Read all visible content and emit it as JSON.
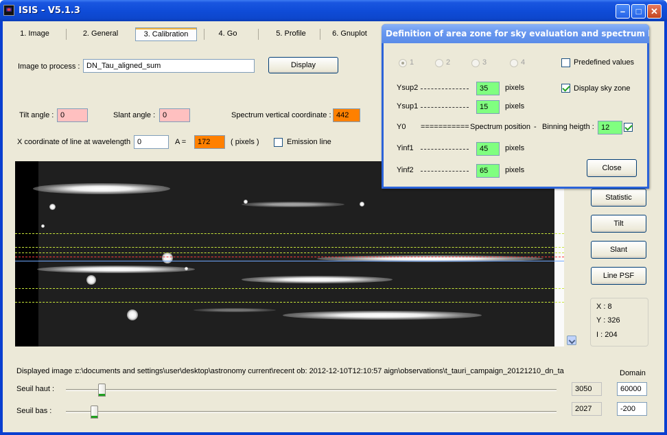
{
  "window": {
    "title": "ISIS - V5.1.3"
  },
  "tabs": [
    {
      "label": "1. Image"
    },
    {
      "label": "2. General"
    },
    {
      "label": "3. Calibration",
      "active": true
    },
    {
      "label": "4. Go"
    },
    {
      "label": "5. Profile"
    },
    {
      "label": "6. Gnuplot"
    }
  ],
  "image_to_process": {
    "label": "Image to process :",
    "value": "DN_Tau_aligned_sum",
    "display_button": "Display"
  },
  "tilt": {
    "label": "Tilt angle :",
    "value": "0"
  },
  "slant": {
    "label": "Slant angle :",
    "value": "0"
  },
  "spectrum_vertical": {
    "label": "Spectrum vertical coordinate :",
    "value": "442"
  },
  "x_coord": {
    "label": "X coordinate of line at wavelength",
    "value": "0",
    "a_label": "A  =",
    "a_value": "172",
    "pixels_label": "( pixels )",
    "emission_label": "Emission line",
    "emission_checked": false
  },
  "side_buttons": {
    "statistic": "Statistic",
    "tilt": "Tilt",
    "slant": "Slant",
    "line_psf": "Line PSF"
  },
  "readout": {
    "x": "X : 8",
    "y": "Y : 326",
    "i": "I   : 204"
  },
  "displayed_image": {
    "label": "Displayed image :",
    "path": "c:\\documents and settings\\user\\desktop\\astronomy current\\recent ob: 2012-12-10T12:10:57 aign\\observations\\t_tauri_campaign_20121210_dn_tau'"
  },
  "domain_label": "Domain",
  "seuil_haut": {
    "label": "Seuil haut :",
    "value": "3050",
    "domain": "60000",
    "level": 0.06
  },
  "seuil_bas": {
    "label": "Seuil bas :",
    "value": "2027",
    "domain": "-200",
    "level": 0.045
  },
  "dialog": {
    "title": "Definition of area zone for sky evaluation and spectrum bi...",
    "radios": [
      "1",
      "2",
      "3",
      "4"
    ],
    "predefined_label": "Predefined values",
    "predefined_checked": false,
    "display_sky_label": "Display sky zone",
    "display_sky_checked": true,
    "ysup2": {
      "label": "Ysup2",
      "value": "35",
      "unit": "pixels"
    },
    "ysup1": {
      "label": "Ysup1",
      "value": "15",
      "unit": "pixels"
    },
    "y0": {
      "label": "Y0",
      "equals": "===========",
      "spectrum_label": "Spectrum position",
      "dash": "-",
      "binning_label": "Binning heigth :",
      "binning_value": "12",
      "binning_checked": true
    },
    "yinf1": {
      "label": "Yinf1",
      "value": "45",
      "unit": "pixels"
    },
    "yinf2": {
      "label": "Yinf2",
      "value": "65",
      "unit": "pixels"
    },
    "close_button": "Close"
  }
}
